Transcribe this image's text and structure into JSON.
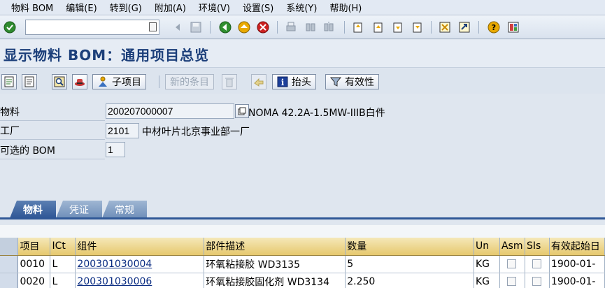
{
  "menu": [
    "物料 BOM",
    "编辑(E)",
    "转到(G)",
    "附加(A)",
    "环境(V)",
    "设置(S)",
    "系统(Y)",
    "帮助(H)"
  ],
  "command_field": {
    "value": ""
  },
  "title": "显示物料 BOM：通用项目总览",
  "app_toolbar": {
    "subitem_label": "子项目",
    "new_entries_label": "新的条目",
    "header_label": "抬头",
    "validity_label": "有效性"
  },
  "header": {
    "material_label": "物料",
    "material_value": "200207000007",
    "material_desc": "NOMA 42.2A-1.5MW-IIIB白件",
    "plant_label": "工厂",
    "plant_value": "2101",
    "plant_desc": "中材叶片北京事业部一厂",
    "alt_bom_label": "可选的 BOM",
    "alt_bom_value": "1"
  },
  "tabs": [
    "物料",
    "凭证",
    "常规"
  ],
  "table": {
    "columns": [
      "项目",
      "ICt",
      "组件",
      "部件描述",
      "数量",
      "Un",
      "Asm",
      "SIs",
      "有效起始日"
    ],
    "rows": [
      {
        "item": "0010",
        "ict": "L",
        "component": "200301030004",
        "desc": "环氧粘接胶 WD3135",
        "qty": "5",
        "unit": "KG",
        "valid_from": "1900-01-"
      },
      {
        "item": "0020",
        "ict": "L",
        "component": "200301030006",
        "desc": "环氧粘接胶固化剂 WD3134",
        "qty": "2.250",
        "unit": "KG",
        "valid_from": "1900-01-"
      }
    ]
  }
}
